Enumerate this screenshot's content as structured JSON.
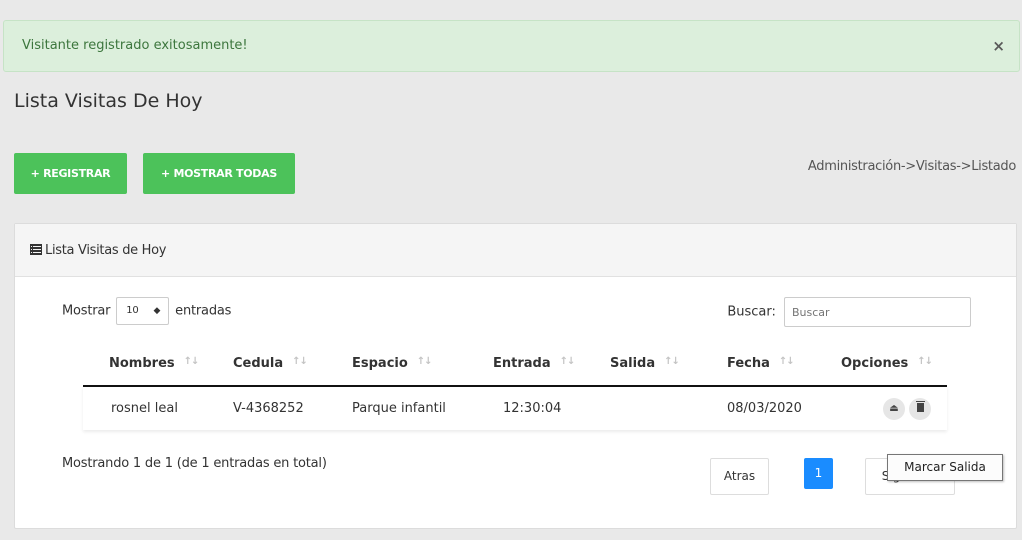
{
  "alert": {
    "message": "Visitante registrado exitosamente!",
    "close": "×"
  },
  "page": {
    "title": "Lista Visitas De Hoy"
  },
  "actions": {
    "register_label": "+ REGISTRAR",
    "show_all_label": "+ MOSTRAR TODAS"
  },
  "breadcrumb": "Administración->Visitas->Listado",
  "panel": {
    "heading": "Lista Visitas de Hoy",
    "length": {
      "prefix": "Mostrar",
      "value": "10",
      "suffix": "entradas"
    },
    "search": {
      "label": "Buscar:",
      "placeholder": "Buscar"
    },
    "columns": [
      "Nombres",
      "Cedula",
      "Espacio",
      "Entrada",
      "Salida",
      "Fecha",
      "Opciones"
    ],
    "sort_glyph": "↑↓",
    "rows": [
      {
        "nombres": "rosnel leal",
        "cedula": "V-4368252",
        "espacio": "Parque infantil",
        "entrada": "12:30:04",
        "salida": "",
        "fecha": "08/03/2020"
      }
    ],
    "info": "Mostrando 1 de 1 (de 1 entradas en total)",
    "pagination": {
      "prev": "Atras",
      "current": "1",
      "next": "Siguiente"
    }
  },
  "tooltip": "Marcar Salida",
  "colors": {
    "success_bg": "#dcefdc",
    "button_green": "#4cc25a",
    "page_active": "#1a8cff"
  }
}
